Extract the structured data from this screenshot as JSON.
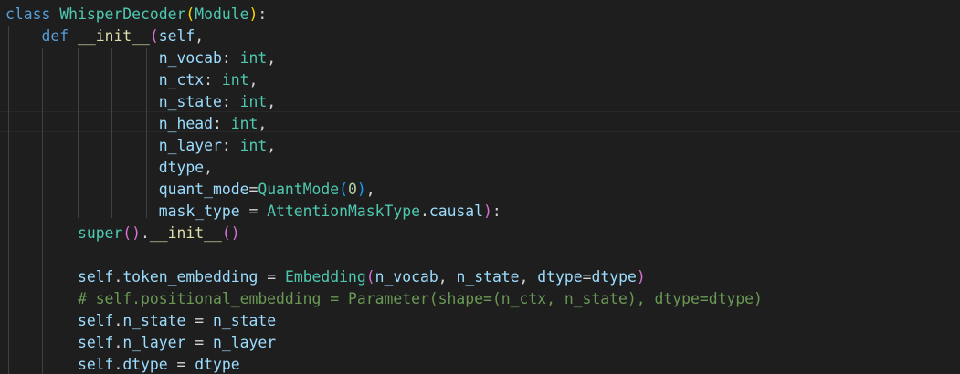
{
  "code_lines": [
    {
      "tokens": [
        {
          "t": "class",
          "c": "kw"
        },
        {
          "t": " ",
          "c": "op"
        },
        {
          "t": "WhisperDecoder",
          "c": "cls"
        },
        {
          "t": "(",
          "c": "p1"
        },
        {
          "t": "Module",
          "c": "cls"
        },
        {
          "t": ")",
          "c": "p1"
        },
        {
          "t": ":",
          "c": "op"
        }
      ]
    },
    {
      "tokens": [
        {
          "t": "    ",
          "c": "op"
        },
        {
          "t": "def",
          "c": "kw"
        },
        {
          "t": " ",
          "c": "op"
        },
        {
          "t": "__init__",
          "c": "fn"
        },
        {
          "t": "(",
          "c": "p2"
        },
        {
          "t": "self",
          "c": "var"
        },
        {
          "t": ",",
          "c": "op"
        }
      ]
    },
    {
      "tokens": [
        {
          "t": "                 ",
          "c": "op"
        },
        {
          "t": "n_vocab",
          "c": "var"
        },
        {
          "t": ": ",
          "c": "op"
        },
        {
          "t": "int",
          "c": "cls"
        },
        {
          "t": ",",
          "c": "op"
        }
      ]
    },
    {
      "tokens": [
        {
          "t": "                 ",
          "c": "op"
        },
        {
          "t": "n_ctx",
          "c": "var"
        },
        {
          "t": ": ",
          "c": "op"
        },
        {
          "t": "int",
          "c": "cls"
        },
        {
          "t": ",",
          "c": "op"
        }
      ]
    },
    {
      "tokens": [
        {
          "t": "                 ",
          "c": "op"
        },
        {
          "t": "n_state",
          "c": "var"
        },
        {
          "t": ": ",
          "c": "op"
        },
        {
          "t": "int",
          "c": "cls"
        },
        {
          "t": ",",
          "c": "op"
        }
      ]
    },
    {
      "tokens": [
        {
          "t": "                 ",
          "c": "op"
        },
        {
          "t": "n_head",
          "c": "var"
        },
        {
          "t": ": ",
          "c": "op"
        },
        {
          "t": "int",
          "c": "cls"
        },
        {
          "t": ",",
          "c": "op"
        }
      ]
    },
    {
      "tokens": [
        {
          "t": "                 ",
          "c": "op"
        },
        {
          "t": "n_layer",
          "c": "var"
        },
        {
          "t": ": ",
          "c": "op"
        },
        {
          "t": "int",
          "c": "cls"
        },
        {
          "t": ",",
          "c": "op"
        }
      ]
    },
    {
      "tokens": [
        {
          "t": "                 ",
          "c": "op"
        },
        {
          "t": "dtype",
          "c": "var"
        },
        {
          "t": ",",
          "c": "op"
        }
      ]
    },
    {
      "tokens": [
        {
          "t": "                 ",
          "c": "op"
        },
        {
          "t": "quant_mode",
          "c": "var"
        },
        {
          "t": "=",
          "c": "op"
        },
        {
          "t": "QuantMode",
          "c": "cls"
        },
        {
          "t": "(",
          "c": "p3"
        },
        {
          "t": "0",
          "c": "num"
        },
        {
          "t": ")",
          "c": "p3"
        },
        {
          "t": ",",
          "c": "op"
        }
      ]
    },
    {
      "tokens": [
        {
          "t": "                 ",
          "c": "op"
        },
        {
          "t": "mask_type",
          "c": "var"
        },
        {
          "t": " = ",
          "c": "op"
        },
        {
          "t": "AttentionMaskType",
          "c": "cls"
        },
        {
          "t": ".",
          "c": "op"
        },
        {
          "t": "causal",
          "c": "var"
        },
        {
          "t": ")",
          "c": "p2"
        },
        {
          "t": ":",
          "c": "op"
        }
      ]
    },
    {
      "tokens": [
        {
          "t": "        ",
          "c": "op"
        },
        {
          "t": "super",
          "c": "cls"
        },
        {
          "t": "()",
          "c": "p2"
        },
        {
          "t": ".",
          "c": "op"
        },
        {
          "t": "__init__",
          "c": "fn"
        },
        {
          "t": "()",
          "c": "p2"
        }
      ]
    },
    {
      "tokens": []
    },
    {
      "tokens": [
        {
          "t": "        ",
          "c": "op"
        },
        {
          "t": "self",
          "c": "var"
        },
        {
          "t": ".",
          "c": "op"
        },
        {
          "t": "token_embedding",
          "c": "var"
        },
        {
          "t": " = ",
          "c": "op"
        },
        {
          "t": "Embedding",
          "c": "cls"
        },
        {
          "t": "(",
          "c": "p2"
        },
        {
          "t": "n_vocab",
          "c": "var"
        },
        {
          "t": ", ",
          "c": "op"
        },
        {
          "t": "n_state",
          "c": "var"
        },
        {
          "t": ", ",
          "c": "op"
        },
        {
          "t": "dtype",
          "c": "var"
        },
        {
          "t": "=",
          "c": "op"
        },
        {
          "t": "dtype",
          "c": "var"
        },
        {
          "t": ")",
          "c": "p2"
        }
      ]
    },
    {
      "tokens": [
        {
          "t": "        ",
          "c": "op"
        },
        {
          "t": "# self.positional_embedding = Parameter(shape=(n_ctx, n_state), dtype=dtype)",
          "c": "com"
        }
      ]
    },
    {
      "tokens": [
        {
          "t": "        ",
          "c": "op"
        },
        {
          "t": "self",
          "c": "var"
        },
        {
          "t": ".",
          "c": "op"
        },
        {
          "t": "n_state",
          "c": "var"
        },
        {
          "t": " = ",
          "c": "op"
        },
        {
          "t": "n_state",
          "c": "var"
        }
      ]
    },
    {
      "tokens": [
        {
          "t": "        ",
          "c": "op"
        },
        {
          "t": "self",
          "c": "var"
        },
        {
          "t": ".",
          "c": "op"
        },
        {
          "t": "n_layer",
          "c": "var"
        },
        {
          "t": " = ",
          "c": "op"
        },
        {
          "t": "n_layer",
          "c": "var"
        }
      ]
    },
    {
      "tokens": [
        {
          "t": "        ",
          "c": "op"
        },
        {
          "t": "self",
          "c": "var"
        },
        {
          "t": ".",
          "c": "op"
        },
        {
          "t": "dtype",
          "c": "var"
        },
        {
          "t": " = ",
          "c": "op"
        },
        {
          "t": "dtype",
          "c": "var"
        }
      ]
    }
  ]
}
